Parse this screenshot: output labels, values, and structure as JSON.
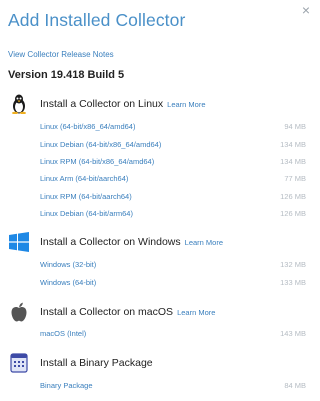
{
  "dialog": {
    "title": "Add Installed Collector",
    "close_glyph": "×",
    "release_notes_label": "View Collector Release Notes",
    "version": "Version 19.418 Build 5"
  },
  "learn_more": "Learn More",
  "sections": {
    "linux": {
      "title": "Install a Collector on Linux",
      "icon": "linux-tux-icon",
      "packages": [
        {
          "name": "Linux (64-bit/x86_64/amd64)",
          "size": "94 MB"
        },
        {
          "name": "Linux Debian (64-bit/x86_64/amd64)",
          "size": "134 MB"
        },
        {
          "name": "Linux RPM (64-bit/x86_64/amd64)",
          "size": "134 MB"
        },
        {
          "name": "Linux Arm (64-bit/aarch64)",
          "size": "77 MB"
        },
        {
          "name": "Linux RPM (64-bit/aarch64)",
          "size": "126 MB"
        },
        {
          "name": "Linux Debian (64-bit/arm64)",
          "size": "126 MB"
        }
      ]
    },
    "windows": {
      "title": "Install a Collector on Windows",
      "icon": "windows-logo-icon",
      "packages": [
        {
          "name": "Windows (32-bit)",
          "size": "132 MB"
        },
        {
          "name": "Windows (64-bit)",
          "size": "133 MB"
        }
      ]
    },
    "macos": {
      "title": "Install a Collector on macOS",
      "icon": "apple-logo-icon",
      "packages": [
        {
          "name": "macOS (Intel)",
          "size": "143 MB"
        }
      ]
    },
    "binary": {
      "title": "Install a Binary Package",
      "icon": "binary-package-icon",
      "packages": [
        {
          "name": "Binary Package",
          "size": "84 MB"
        }
      ]
    }
  },
  "colors": {
    "title": "#4a90c8",
    "link": "#3a7fbd",
    "size_text": "#b5bcc3",
    "windows_blue": "#1e88e5"
  }
}
